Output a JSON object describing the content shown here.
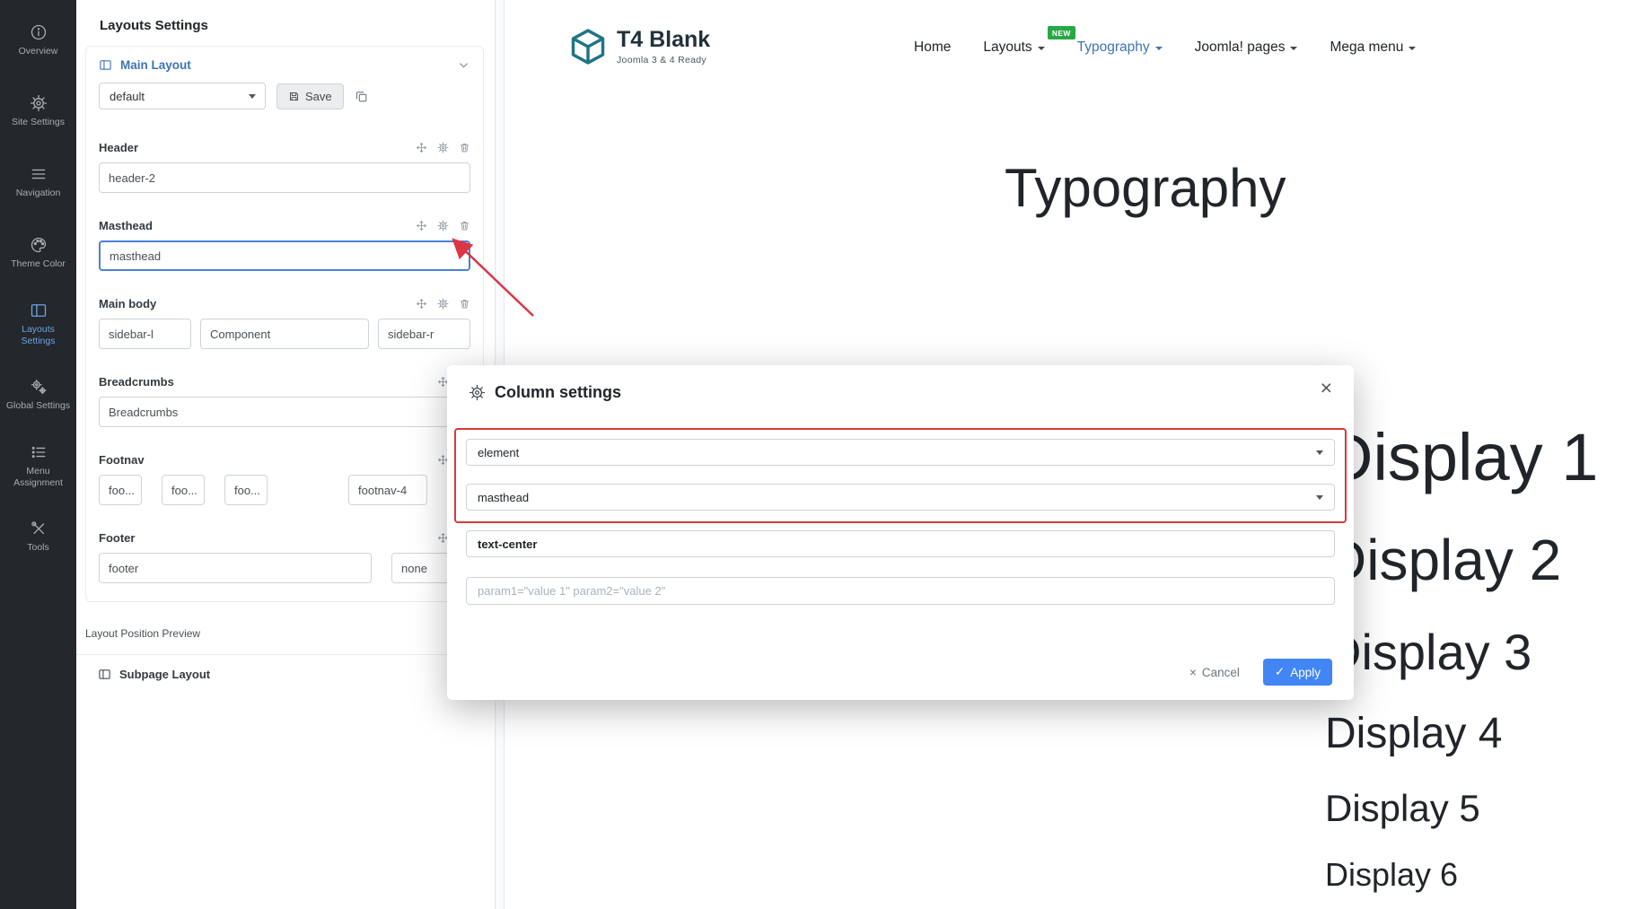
{
  "colors": {
    "accent_blue": "#3d74b8",
    "highlight_red": "#d63a3a",
    "badge_green": "#28a745",
    "apply_blue": "#4285f4"
  },
  "sidebar": {
    "items": [
      {
        "label": "Overview"
      },
      {
        "label": "Site Settings"
      },
      {
        "label": "Navigation"
      },
      {
        "label": "Theme Color"
      },
      {
        "label": "Layouts Settings"
      },
      {
        "label": "Global Settings"
      },
      {
        "label": "Menu Assignment"
      },
      {
        "label": "Tools"
      }
    ]
  },
  "panel": {
    "title": "Layouts Settings",
    "main_layout_title": "Main Layout",
    "profile": "default",
    "save_label": "Save",
    "sections": {
      "header": {
        "name": "Header",
        "block": "header-2"
      },
      "masthead": {
        "name": "Masthead",
        "block": "masthead"
      },
      "mainbody": {
        "name": "Main body",
        "blocks": [
          "sidebar-l",
          "Component",
          "sidebar-r"
        ]
      },
      "breadcrumbs": {
        "name": "Breadcrumbs",
        "block": "Breadcrumbs"
      },
      "footnav": {
        "name": "Footnav",
        "blocks": [
          "foo...",
          "foo...",
          "foo...",
          "footnav-4"
        ]
      },
      "footer": {
        "name": "Footer",
        "blocks": [
          "footer",
          "none"
        ]
      }
    },
    "preview_label": "Layout Position Preview",
    "subpage_title": "Subpage Layout"
  },
  "site": {
    "logo_title": "T4 Blank",
    "logo_subtitle": "Joomla 3 & 4 Ready",
    "nav": [
      {
        "label": "Home"
      },
      {
        "label": "Layouts",
        "badge": "NEW"
      },
      {
        "label": "Typography"
      },
      {
        "label": "Joomla! pages"
      },
      {
        "label": "Mega menu"
      }
    ],
    "heading": "Typography",
    "displays": [
      "Display 1",
      "Display 2",
      "Display 3",
      "Display 4",
      "Display 5",
      "Display 6"
    ]
  },
  "modal": {
    "title": "Column settings",
    "type_value": "element",
    "position_value": "masthead",
    "css_value": "text-center",
    "params_placeholder": "param1=\"value 1\" param2=\"value 2\"",
    "cancel_label": "Cancel",
    "apply_label": "Apply"
  }
}
